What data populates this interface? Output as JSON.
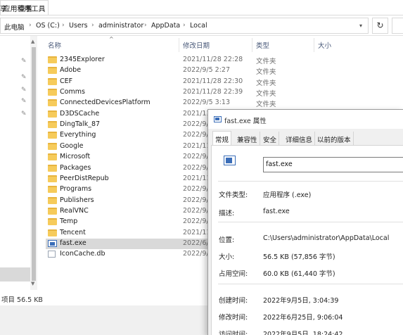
{
  "ribbon": {
    "tabs": [
      "享",
      "查看"
    ],
    "tools_tab": "应用程序工具"
  },
  "address": {
    "crumbs": [
      "此电脑",
      "OS (C:)",
      "Users",
      "administrator",
      "AppData",
      "Local"
    ],
    "separator": "›"
  },
  "columns": {
    "name": "名称",
    "date": "修改日期",
    "type": "类型",
    "size": "大小"
  },
  "files": [
    {
      "name": "2345Explorer",
      "date": "2021/11/28 22:28",
      "type": "文件夹",
      "kind": "folder"
    },
    {
      "name": "Adobe",
      "date": "2022/9/5 2:27",
      "type": "文件夹",
      "kind": "folder"
    },
    {
      "name": "CEF",
      "date": "2021/11/28 22:30",
      "type": "文件夹",
      "kind": "folder"
    },
    {
      "name": "Comms",
      "date": "2021/11/28 22:39",
      "type": "文件夹",
      "kind": "folder"
    },
    {
      "name": "ConnectedDevicesPlatform",
      "date": "2022/9/5 3:13",
      "type": "文件夹",
      "kind": "folder"
    },
    {
      "name": "D3DSCache",
      "date": "2021/11",
      "type": "",
      "kind": "folder"
    },
    {
      "name": "DingTalk_87",
      "date": "2022/9/",
      "type": "",
      "kind": "folder"
    },
    {
      "name": "Everything",
      "date": "2022/9/",
      "type": "",
      "kind": "folder"
    },
    {
      "name": "Google",
      "date": "2021/11",
      "type": "",
      "kind": "folder"
    },
    {
      "name": "Microsoft",
      "date": "2022/9/",
      "type": "",
      "kind": "folder"
    },
    {
      "name": "Packages",
      "date": "2022/9/",
      "type": "",
      "kind": "folder"
    },
    {
      "name": "PeerDistRepub",
      "date": "2021/11",
      "type": "",
      "kind": "folder"
    },
    {
      "name": "Programs",
      "date": "2022/9/",
      "type": "",
      "kind": "folder"
    },
    {
      "name": "Publishers",
      "date": "2022/9/",
      "type": "",
      "kind": "folder"
    },
    {
      "name": "RealVNC",
      "date": "2022/9/",
      "type": "",
      "kind": "folder"
    },
    {
      "name": "Temp",
      "date": "2022/9/",
      "type": "",
      "kind": "folder"
    },
    {
      "name": "Tencent",
      "date": "2021/11",
      "type": "",
      "kind": "folder"
    },
    {
      "name": "fast.exe",
      "date": "2022/6/",
      "type": "",
      "kind": "exe",
      "selected": true
    },
    {
      "name": "IconCache.db",
      "date": "2022/9/",
      "type": "",
      "kind": "db"
    }
  ],
  "status": {
    "text": "项目  56.5 KB"
  },
  "dialog": {
    "title": "fast.exe 属性",
    "tabs": [
      "常规",
      "兼容性",
      "安全",
      "详细信息",
      "以前的版本"
    ],
    "active_tab": "常规",
    "filename": "fast.exe",
    "file_type_label": "文件类型:",
    "file_type": "应用程序 (.exe)",
    "description_label": "描述:",
    "description": "fast.exe",
    "location_label": "位置:",
    "location": "C:\\Users\\administrator\\AppData\\Local",
    "size_label": "大小:",
    "size": "56.5 KB (57,856 字节)",
    "size_on_disk_label": "占用空间:",
    "size_on_disk": "60.0 KB (61,440 字节)",
    "created_label": "创建时间:",
    "created": "2022年9月5日, 3:04:39",
    "modified_label": "修改时间:",
    "modified": "2022年6月25日, 9:06:04",
    "accessed_label": "访问时间:",
    "accessed": "2022年9月5日, 18:24:42"
  },
  "icons": {
    "pin": "pin-icon",
    "folder": "folder-icon",
    "exe": "application-icon",
    "refresh": "refresh-icon"
  },
  "colors": {
    "folder": "#f6cb5b",
    "selection": "#d9d9d9",
    "header_text": "#4a5a7a",
    "exe_blue": "#3a6db8"
  }
}
